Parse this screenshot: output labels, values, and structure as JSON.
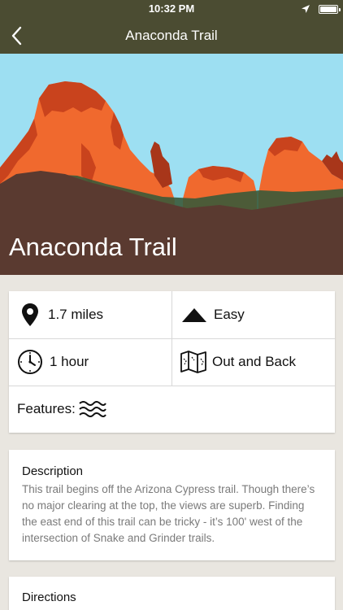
{
  "status_bar": {
    "time": "10:32 PM"
  },
  "nav": {
    "title": "Anaconda Trail"
  },
  "hero": {
    "title": "Anaconda Trail"
  },
  "stats": {
    "distance": "1.7 miles",
    "difficulty": "Easy",
    "duration": "1 hour",
    "route_type": "Out and Back",
    "features_label": "Features:"
  },
  "description": {
    "label": "Description",
    "text": "This trail begins off the Arizona Cypress trail. Though there’s no major clearing at the top, the views are superb. Finding the east end of this trail can be tricky - it’s 100' west of the intersection of Snake and Grinder trails."
  },
  "directions": {
    "label": "Directions"
  },
  "colors": {
    "nav_bg": "#4b4c32",
    "sky": "#9ddff2",
    "rock_orange": "#f0692e",
    "rock_dark": "#c9431d",
    "ground": "#5a3a30",
    "page_bg": "#e9e6e0"
  },
  "icons": [
    "back-chevron",
    "location-arrow",
    "battery",
    "map-pin",
    "mountain-triangle",
    "clock",
    "folded-map",
    "water-waves"
  ]
}
